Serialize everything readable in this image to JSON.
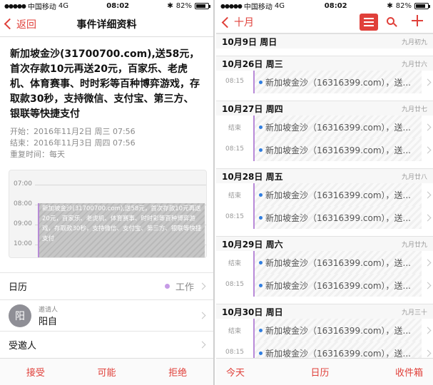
{
  "status_left": {
    "carrier": "中国移动",
    "network": "4G",
    "time": "08:02",
    "battery": "82%",
    "battery_level": 0.82
  },
  "status_right": {
    "carrier": "中国移动",
    "network": "4G",
    "time": "08:02",
    "battery": "82%",
    "battery_level": 0.82
  },
  "detail": {
    "back_label": "返回",
    "title": "事件详细资料",
    "event_title": "新加坡金沙(31700700.com),送58元，首次存款10元再送20元，百家乐、老虎机、体育赛事、时时彩等百种博弈游戏，存取款30秒，支持微信、支付宝、第三方、银联等快捷支付",
    "start": "开始：2016年11月2日 周三 07:56",
    "end": "结束：2016年11月3日 周四 07:56",
    "repeat": "重复时间：每天",
    "hours": [
      "07:00",
      "08:00",
      "09:00",
      "10:00"
    ],
    "block_text": "新加坡金沙(31700700.com),送58元，首次存款10元再送20元，百家乐、老虎机、体育赛事、时时彩等百种博弈游戏，存取款30秒，支持微信、支付宝、第三方、银联等快捷支付",
    "calendar_label": "日历",
    "calendar_value": "工作",
    "invitee_small": "邀请人",
    "invitee_name": "阳自",
    "avatar_letter": "阳",
    "guests_label": "受邀人",
    "accent_color": "#e0403a",
    "actions": {
      "accept": "接受",
      "maybe": "可能",
      "decline": "拒绝"
    }
  },
  "list": {
    "back_label": "十月",
    "event_text": "新加坡金沙（16316399.com），送...",
    "days": [
      {
        "date": "10月9日 周日",
        "lunar": "九月初九",
        "events": []
      },
      {
        "date": "10月26日 周三",
        "lunar": "九月廿六",
        "events": [
          {
            "time": "08:15"
          }
        ]
      },
      {
        "date": "10月27日 周四",
        "lunar": "九月廿七",
        "events": [
          {
            "time": "结束"
          },
          {
            "time": "08:15"
          }
        ]
      },
      {
        "date": "10月28日 周五",
        "lunar": "九月廿八",
        "events": [
          {
            "time": "结束"
          },
          {
            "time": "08:15"
          }
        ]
      },
      {
        "date": "10月29日 周六",
        "lunar": "九月廿九",
        "events": [
          {
            "time": "结束"
          },
          {
            "time": "08:15"
          }
        ]
      },
      {
        "date": "10月30日 周日",
        "lunar": "九月三十",
        "events": [
          {
            "time": "结束"
          },
          {
            "time": "08:15"
          }
        ]
      }
    ],
    "tabs": {
      "today": "今天",
      "calendars": "日历",
      "inbox": "收件箱"
    }
  }
}
